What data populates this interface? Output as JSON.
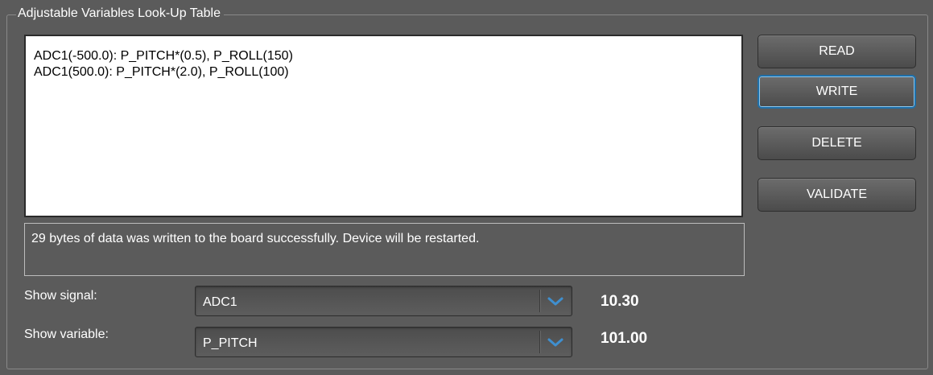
{
  "group": {
    "title": "Adjustable Variables Look-Up Table"
  },
  "table": {
    "lines": [
      "ADC1(-500.0): P_PITCH*(0.5),  P_ROLL(150)",
      "ADC1(500.0): P_PITCH*(2.0),  P_ROLL(100)"
    ]
  },
  "status": {
    "message": "29 bytes of data was written to the board successfully. Device will be restarted."
  },
  "buttons": {
    "read": "READ",
    "write": "WRITE",
    "delete": "DELETE",
    "validate": "VALIDATE"
  },
  "signal": {
    "label": "Show signal:",
    "selected": "ADC1",
    "value": "10.30"
  },
  "variable": {
    "label": "Show variable:",
    "selected": "P_PITCH",
    "value": "101.00"
  },
  "colors": {
    "background": "#5b5b5b",
    "focus_border": "#1f6fa8",
    "arrow": "#3f8fcf"
  },
  "icons": {
    "dropdown": "chevron-down-icon"
  }
}
